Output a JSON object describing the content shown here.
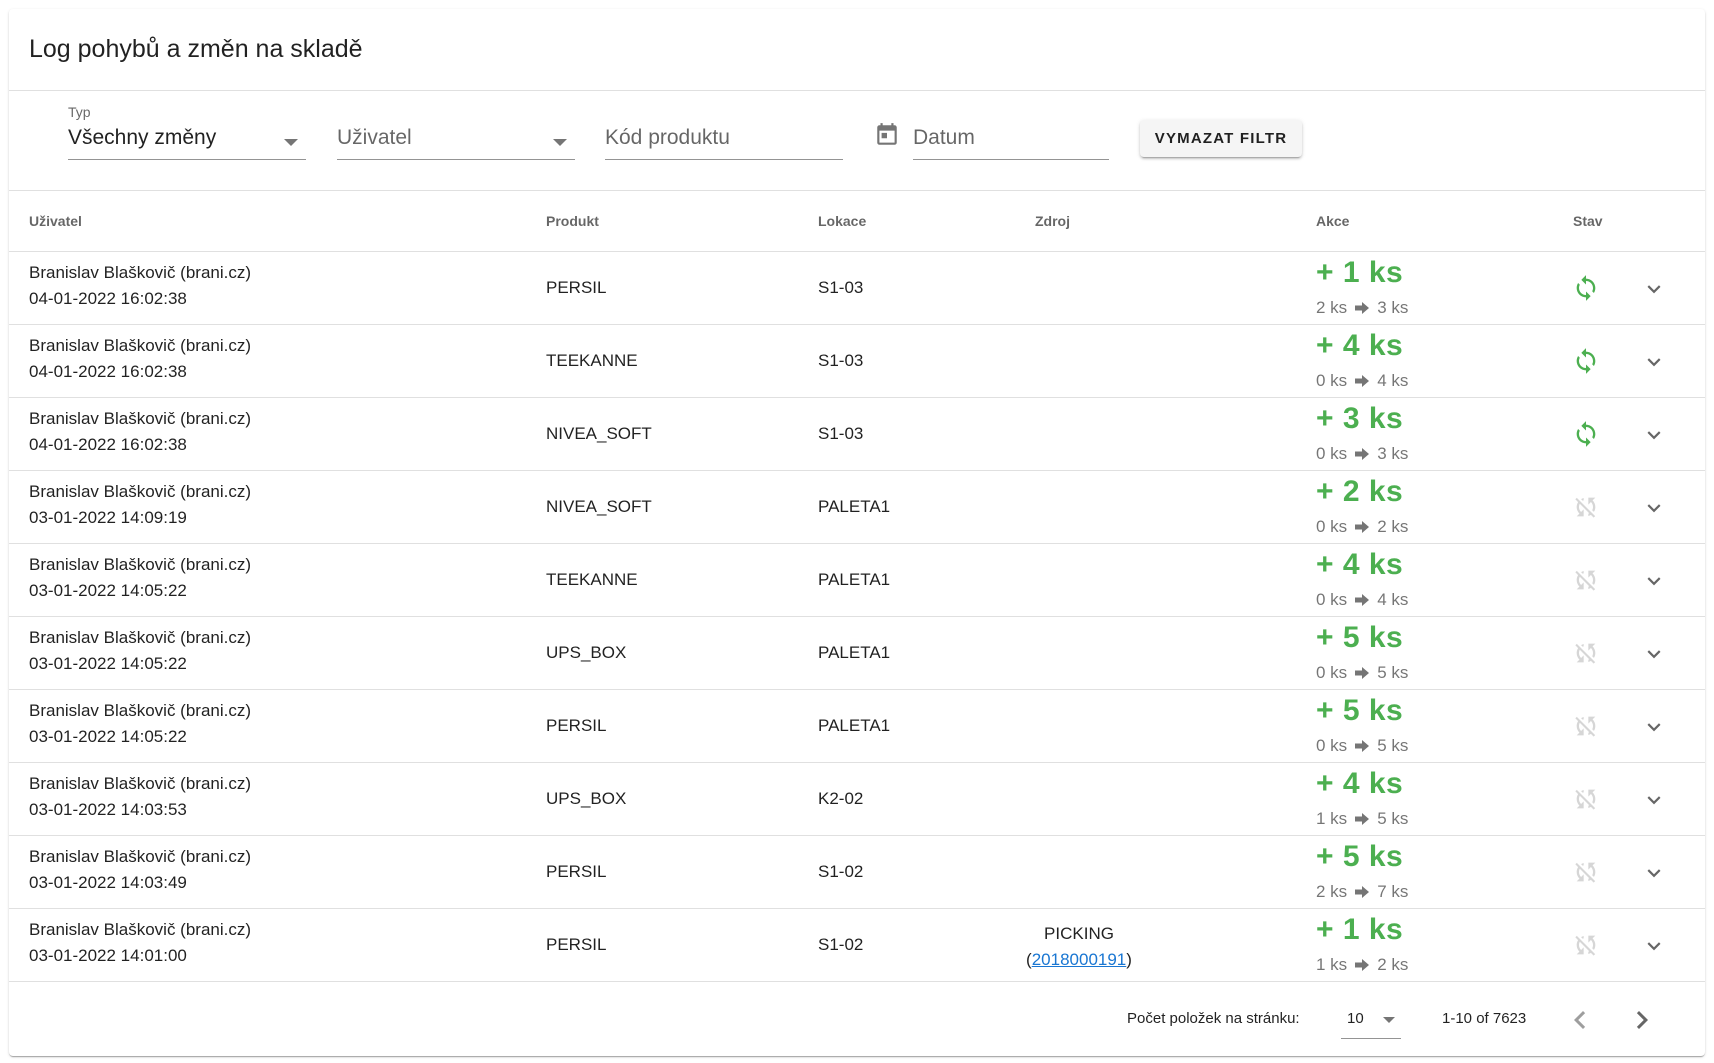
{
  "page": {
    "title": "Log pohybů a změn na skladě"
  },
  "filters": {
    "type": {
      "label": "Typ",
      "value": "Všechny změny"
    },
    "user": {
      "placeholder": "Uživatel"
    },
    "product_code": {
      "placeholder": "Kód produktu"
    },
    "date": {
      "placeholder": "Datum"
    },
    "clear_button": "VYMAZAT FILTR"
  },
  "table": {
    "headers": {
      "user": "Uživatel",
      "product": "Produkt",
      "location": "Lokace",
      "source": "Zdroj",
      "action": "Akce",
      "state": "Stav"
    },
    "rows": [
      {
        "user": "Branislav Blaškovič (brani.cz)",
        "date": "04-01-2022 16:02:38",
        "product": "PERSIL",
        "location": "S1-03",
        "source": "",
        "source_link": "",
        "action": "+ 1 ks",
        "from": "2 ks",
        "to": "3 ks",
        "synced": true
      },
      {
        "user": "Branislav Blaškovič (brani.cz)",
        "date": "04-01-2022 16:02:38",
        "product": "TEEKANNE",
        "location": "S1-03",
        "source": "",
        "source_link": "",
        "action": "+ 4 ks",
        "from": "0 ks",
        "to": "4 ks",
        "synced": true
      },
      {
        "user": "Branislav Blaškovič (brani.cz)",
        "date": "04-01-2022 16:02:38",
        "product": "NIVEA_SOFT",
        "location": "S1-03",
        "source": "",
        "source_link": "",
        "action": "+ 3 ks",
        "from": "0 ks",
        "to": "3 ks",
        "synced": true
      },
      {
        "user": "Branislav Blaškovič (brani.cz)",
        "date": "03-01-2022 14:09:19",
        "product": "NIVEA_SOFT",
        "location": "PALETA1",
        "source": "",
        "source_link": "",
        "action": "+ 2 ks",
        "from": "0 ks",
        "to": "2 ks",
        "synced": false
      },
      {
        "user": "Branislav Blaškovič (brani.cz)",
        "date": "03-01-2022 14:05:22",
        "product": "TEEKANNE",
        "location": "PALETA1",
        "source": "",
        "source_link": "",
        "action": "+ 4 ks",
        "from": "0 ks",
        "to": "4 ks",
        "synced": false
      },
      {
        "user": "Branislav Blaškovič (brani.cz)",
        "date": "03-01-2022 14:05:22",
        "product": "UPS_BOX",
        "location": "PALETA1",
        "source": "",
        "source_link": "",
        "action": "+ 5 ks",
        "from": "0 ks",
        "to": "5 ks",
        "synced": false
      },
      {
        "user": "Branislav Blaškovič (brani.cz)",
        "date": "03-01-2022 14:05:22",
        "product": "PERSIL",
        "location": "PALETA1",
        "source": "",
        "source_link": "",
        "action": "+ 5 ks",
        "from": "0 ks",
        "to": "5 ks",
        "synced": false
      },
      {
        "user": "Branislav Blaškovič (brani.cz)",
        "date": "03-01-2022 14:03:53",
        "product": "UPS_BOX",
        "location": "K2-02",
        "source": "",
        "source_link": "",
        "action": "+ 4 ks",
        "from": "1 ks",
        "to": "5 ks",
        "synced": false
      },
      {
        "user": "Branislav Blaškovič (brani.cz)",
        "date": "03-01-2022 14:03:49",
        "product": "PERSIL",
        "location": "S1-02",
        "source": "",
        "source_link": "",
        "action": "+ 5 ks",
        "from": "2 ks",
        "to": "7 ks",
        "synced": false
      },
      {
        "user": "Branislav Blaškovič (brani.cz)",
        "date": "03-01-2022 14:01:00",
        "product": "PERSIL",
        "location": "S1-02",
        "source": "PICKING",
        "source_link": "2018000191",
        "action": "+ 1 ks",
        "from": "1 ks",
        "to": "2 ks",
        "synced": false
      }
    ]
  },
  "pagination": {
    "per_page_label": "Počet položek na stránku:",
    "per_page": "10",
    "range": "1-10 of 7623"
  },
  "colors": {
    "accent_green": "#4caf50",
    "disabled_icon": "#d6d6d6",
    "link": "#1976d2"
  },
  "icons": {
    "synced": "sync-icon",
    "not_synced": "sync-disabled-icon",
    "expand": "chevron-down-icon",
    "date": "calendar-icon",
    "arrow": "arrow-right-icon"
  }
}
